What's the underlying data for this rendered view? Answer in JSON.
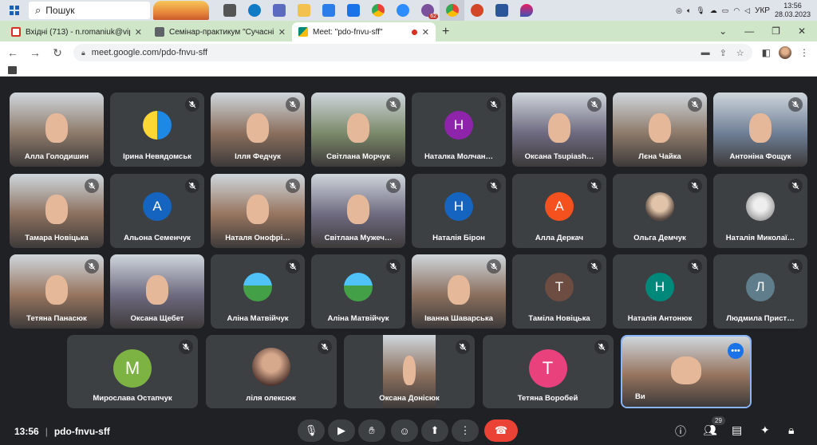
{
  "taskbar": {
    "search_placeholder": "Пошук",
    "lang": "УКР",
    "time": "13:56",
    "date": "28.03.2023",
    "mail_badge": "62"
  },
  "browser": {
    "tabs": [
      {
        "title": "Вхідні (713) - n.romaniuk@vippo",
        "favicon_color": "#d93025"
      },
      {
        "title": "Семінар-практикум \"Сучасні те",
        "favicon_color": "#5f6368"
      },
      {
        "title": "Meet: \"pdo-fnvu-sff\"",
        "favicon_color": "#00897b",
        "active": true
      }
    ],
    "url": "meet.google.com/pdo-fnvu-sff"
  },
  "participants": [
    {
      "name": "Алла Голодишин",
      "type": "video",
      "muted": false
    },
    {
      "name": "Ірина Невядомськ",
      "type": "picture",
      "muted": true
    },
    {
      "name": "Ілля Федчук",
      "type": "video",
      "muted": true
    },
    {
      "name": "Світлана Морчук",
      "type": "video",
      "muted": true
    },
    {
      "name": "Наталка Молчан…",
      "type": "avatar",
      "initial": "Н",
      "color": "#8e24aa",
      "muted": true
    },
    {
      "name": "Оксана Tsupiash…",
      "type": "video",
      "muted": true
    },
    {
      "name": "Лєна Чайка",
      "type": "video",
      "muted": true
    },
    {
      "name": "Антоніна Фощук",
      "type": "video",
      "muted": true
    },
    {
      "name": "Тамара Новіцька",
      "type": "video",
      "muted": true
    },
    {
      "name": "Альона Семенчук",
      "type": "avatar",
      "initial": "А",
      "color": "#1565c0",
      "muted": true
    },
    {
      "name": "Наталя Онофрі…",
      "type": "video",
      "muted": true
    },
    {
      "name": "Світлана Мужеч…",
      "type": "video",
      "muted": true
    },
    {
      "name": "Наталія Бірон",
      "type": "avatar",
      "initial": "Н",
      "color": "#1565c0",
      "muted": true
    },
    {
      "name": "Алла Деркач",
      "type": "avatar",
      "initial": "А",
      "color": "#f4511e",
      "muted": true
    },
    {
      "name": "Ольга Демчук",
      "type": "picture",
      "muted": true
    },
    {
      "name": "Наталія Миколаї…",
      "type": "picture",
      "muted": true
    },
    {
      "name": "Тетяна Панасюк",
      "type": "video",
      "muted": true
    },
    {
      "name": "Оксана Щебет",
      "type": "video",
      "muted": false
    },
    {
      "name": "Аліна Матвійчук",
      "type": "picture",
      "muted": true
    },
    {
      "name": "Аліна Матвійчук",
      "type": "picture",
      "muted": true
    },
    {
      "name": "Іванна Шаварська",
      "type": "video",
      "muted": true
    },
    {
      "name": "Таміла Новіцька",
      "type": "avatar",
      "initial": "Т",
      "color": "#6d4c41",
      "muted": true
    },
    {
      "name": "Наталія Антонюк",
      "type": "avatar",
      "initial": "Н",
      "color": "#00897b",
      "muted": true
    },
    {
      "name": "Людмила Прист…",
      "type": "avatar",
      "initial": "Л",
      "color": "#607d8b",
      "muted": true
    },
    {
      "name": "Мирослава Остапчук",
      "type": "avatar",
      "initial": "М",
      "color": "#7cb342",
      "muted": true
    },
    {
      "name": "ліля олексюк",
      "type": "picture",
      "muted": true
    },
    {
      "name": "Оксана Донісюк",
      "type": "video",
      "muted": true
    },
    {
      "name": "Тетяна Воробей",
      "type": "avatar",
      "initial": "Т",
      "color": "#e8417c",
      "muted": true
    },
    {
      "name": "Ви",
      "type": "video",
      "muted": false,
      "self": true
    }
  ],
  "meeting": {
    "time": "13:56",
    "code": "pdo-fnvu-sff",
    "people_count": "29"
  },
  "colors": {
    "background": "#202124",
    "tile": "#3c4043",
    "leave": "#ea4335",
    "self_border": "#8ab4f8"
  }
}
